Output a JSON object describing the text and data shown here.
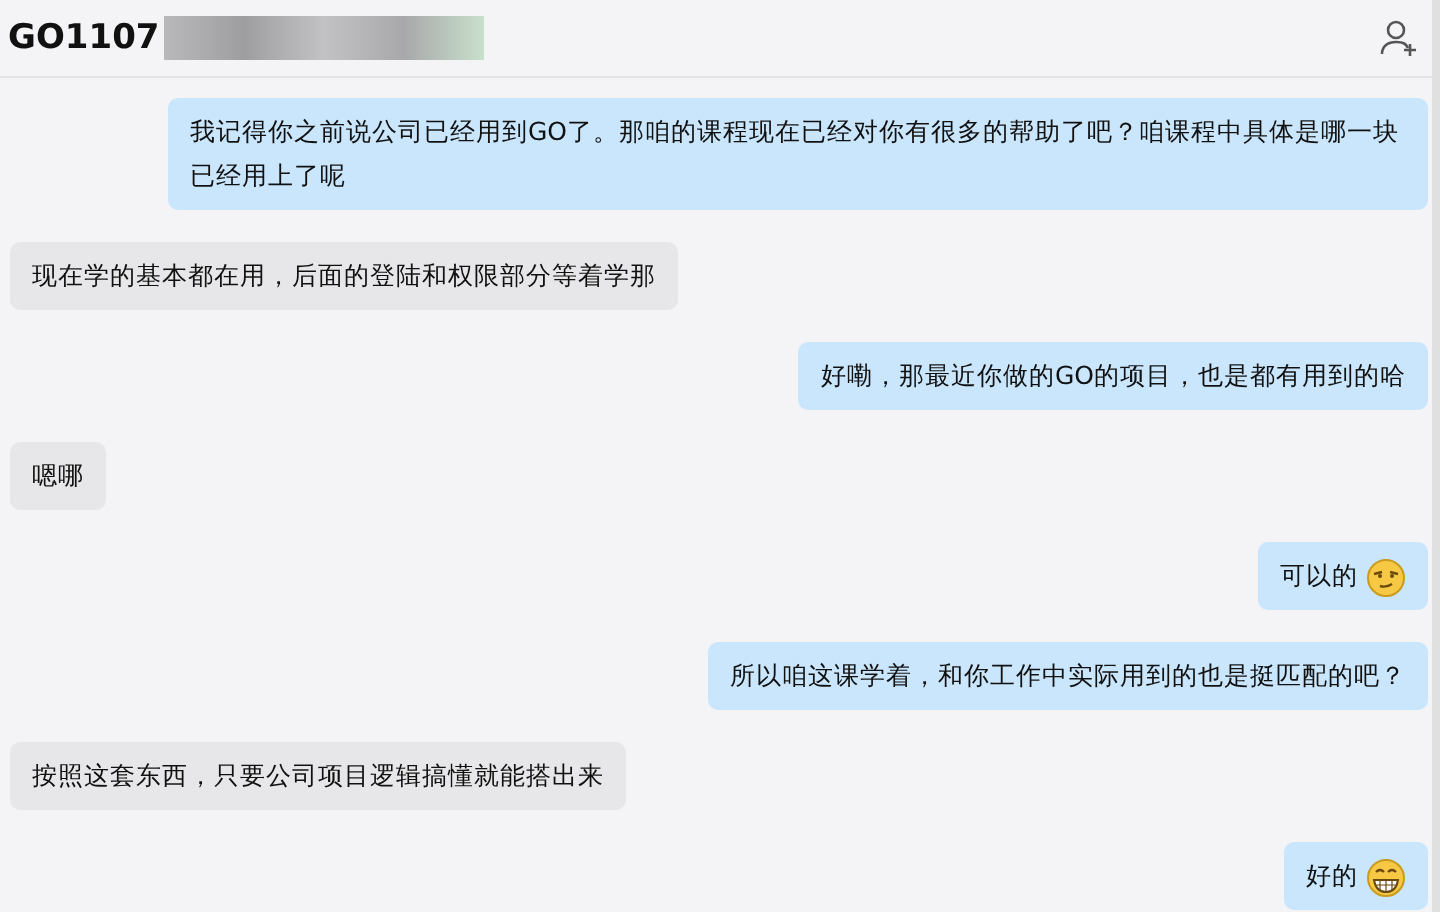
{
  "header": {
    "title": "GO1107",
    "title_blurred": true
  },
  "messages": [
    {
      "outgoing": true,
      "kind": "plain",
      "text": "我记得你之前说公司已经用到GO了。那咱的课程现在已经对你有很多的帮助了吧？咱课程中具体是哪一块已经用上了呢"
    },
    {
      "outgoing": false,
      "kind": "plain",
      "text": "现在学的基本都在用，后面的登陆和权限部分等着学那"
    },
    {
      "outgoing": true,
      "kind": "plain",
      "text": "好嘞，那最近你做的GO的项目，也是都有用到的哈"
    },
    {
      "outgoing": false,
      "kind": "plain",
      "text": "嗯哪"
    },
    {
      "outgoing": true,
      "kind": "smirk",
      "text": "可以的"
    },
    {
      "outgoing": true,
      "kind": "plain",
      "text": "所以咱这课学着，和你工作中实际用到的也是挺匹配的吧？"
    },
    {
      "outgoing": false,
      "kind": "plain",
      "text": "按照这套东西，只要公司项目逻辑搞懂就能搭出来"
    },
    {
      "outgoing": true,
      "kind": "grin",
      "text": "好的"
    }
  ]
}
